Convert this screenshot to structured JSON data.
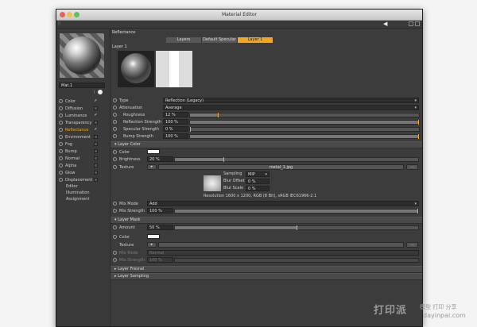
{
  "window": {
    "title": "Material Editor"
  },
  "material": {
    "name": "Mat.1",
    "tools": "i"
  },
  "channels": [
    {
      "label": "Color",
      "checked": true,
      "active": false
    },
    {
      "label": "Diffusion",
      "checked": false,
      "active": false
    },
    {
      "label": "Luminance",
      "checked": true,
      "active": false
    },
    {
      "label": "Transparency",
      "checked": false,
      "active": false
    },
    {
      "label": "Reflectance",
      "checked": true,
      "active": true
    },
    {
      "label": "Environment",
      "checked": false,
      "active": false
    },
    {
      "label": "Fog",
      "checked": false,
      "active": false
    },
    {
      "label": "Bump",
      "checked": false,
      "active": false
    },
    {
      "label": "Normal",
      "checked": false,
      "active": false
    },
    {
      "label": "Alpha",
      "checked": false,
      "active": false
    },
    {
      "label": "Glow",
      "checked": false,
      "active": false
    },
    {
      "label": "Displacement",
      "checked": false,
      "active": false
    }
  ],
  "extra_items": [
    "Editor",
    "Illumination",
    "Assignment"
  ],
  "panel": {
    "header": "Reflectance",
    "tabs": [
      "Layers",
      "Default Specular",
      "Layer 1"
    ],
    "layer_label": "Layer 1"
  },
  "props": {
    "type": {
      "label": "Type",
      "value": "Reflection (Legacy)"
    },
    "attenuation": {
      "label": "Attenuation",
      "value": "Average"
    },
    "roughness": {
      "label": "Roughness",
      "value": "12 %",
      "pct": 12
    },
    "refl_strength": {
      "label": "Reflection Strength",
      "value": "100 %",
      "pct": 100
    },
    "spec_strength": {
      "label": "Specular Strength",
      "value": "0 %",
      "pct": 0
    },
    "bump_strength": {
      "label": "Bump Strength",
      "value": "100 %",
      "pct": 100
    }
  },
  "layer_color": {
    "section": "Layer Color",
    "color_label": "Color",
    "brightness": {
      "label": "Brightness",
      "value": "20 %",
      "pct": 20
    },
    "texture_label": "Texture",
    "texture_file": "metal_1.jpg",
    "browse": "...",
    "sampling": {
      "label": "Sampling",
      "value": "MIP"
    },
    "blur_offset": {
      "label": "Blur Offset",
      "value": "0 %"
    },
    "blur_scale": {
      "label": "Blur Scale",
      "value": "0 %"
    },
    "resolution": "Resolution 1600 x 1200, RGB (8 Bit), sRGB IEC61966-2.1",
    "mix_mode": {
      "label": "Mix Mode",
      "value": "Add"
    },
    "mix_strength": {
      "label": "Mix Strength",
      "value": "100 %",
      "pct": 100
    }
  },
  "layer_mask": {
    "section": "Layer Mask",
    "amount": {
      "label": "Amount",
      "value": "50 %",
      "pct": 50
    },
    "color_label": "Color",
    "texture_label": "Texture",
    "browse": "...",
    "mix_mode": {
      "label": "Mix Mode",
      "value": "Normal"
    },
    "mix_strength": {
      "label": "Mix Strength",
      "value": "100 %",
      "pct": 100
    }
  },
  "collapsed_sections": [
    "Layer Fresnel",
    "Layer Sampling"
  ],
  "watermark": {
    "brand": "打印派",
    "sub": "模型 打印 分享",
    "url": "dayinpai.com"
  },
  "colors": {
    "accent": "#f4a71d",
    "panel": "#3c3c3c"
  }
}
